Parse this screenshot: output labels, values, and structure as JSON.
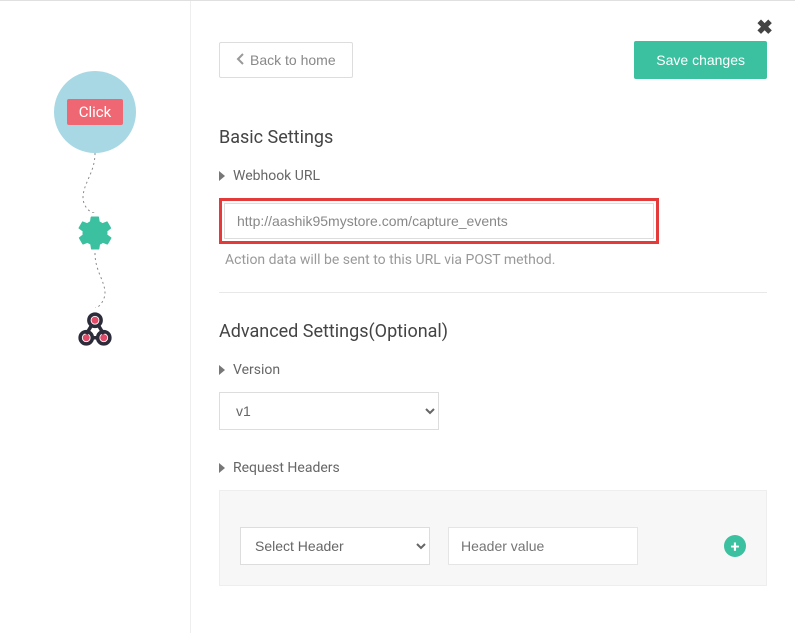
{
  "topbar": {
    "back_label": "Back to home",
    "save_label": "Save changes"
  },
  "sidebar": {
    "click_badge": "Click"
  },
  "basic": {
    "title": "Basic Settings",
    "webhook_label": "Webhook URL",
    "webhook_value": "http://aashik95mystore.com/capture_events",
    "webhook_help": "Action data will be sent to this URL via POST method."
  },
  "advanced": {
    "title": "Advanced Settings(Optional)",
    "version_label": "Version",
    "version_value": "v1",
    "headers_label": "Request Headers",
    "header_select_placeholder": "Select Header",
    "header_value_placeholder": "Header value"
  }
}
